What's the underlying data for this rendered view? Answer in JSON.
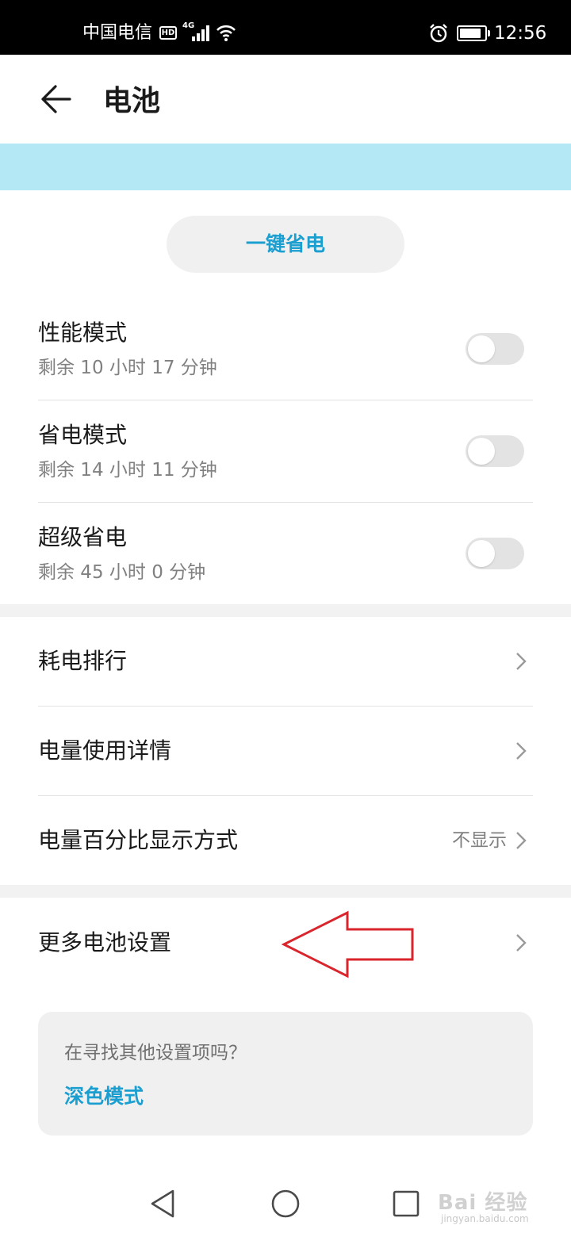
{
  "status_bar": {
    "carrier": "中国电信",
    "hd": "HD",
    "network": "4G",
    "time": "12:56",
    "icons": [
      "signal-icon",
      "wifi-icon",
      "alarm-icon",
      "battery-icon"
    ]
  },
  "header": {
    "title": "电池",
    "back_icon": "arrow-left-icon"
  },
  "onekey": {
    "label": "一键省电",
    "color": "#1a9fd0"
  },
  "modes": [
    {
      "title": "性能模式",
      "subtitle": "剩余 10 小时 17 分钟",
      "enabled": false
    },
    {
      "title": "省电模式",
      "subtitle": "剩余 14 小时 11 分钟",
      "enabled": false
    },
    {
      "title": "超级省电",
      "subtitle": "剩余 45 小时 0 分钟",
      "enabled": false
    }
  ],
  "list": [
    {
      "label": "耗电排行",
      "value": ""
    },
    {
      "label": "电量使用详情",
      "value": ""
    },
    {
      "label": "电量百分比显示方式",
      "value": "不显示"
    }
  ],
  "more": {
    "label": "更多电池设置"
  },
  "suggest": {
    "question": "在寻找其他设置项吗？",
    "link": "深色模式"
  },
  "navbar": {
    "icons": [
      "back-triangle-icon",
      "home-circle-icon",
      "recents-square-icon"
    ]
  },
  "watermark": {
    "brand": "Bai 经验",
    "url": "jingyan.baidu.com"
  },
  "colors": {
    "accent": "#1a9fd0",
    "banner": "#b4e8f4",
    "annotation": "#d9252b"
  }
}
